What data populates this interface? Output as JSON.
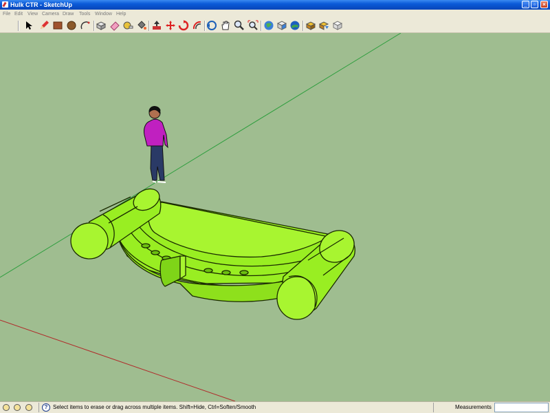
{
  "window": {
    "title": "Hulk CTR - SketchUp"
  },
  "menu": {
    "items": [
      "File",
      "Edit",
      "View",
      "Camera",
      "Draw",
      "Tools",
      "Window",
      "Help"
    ]
  },
  "colors": {
    "viewport": "#9fbd90",
    "model": "#99ee22",
    "person_shirt": "#c020c0",
    "green_axis": "#2e9e3e",
    "red_axis": "#b02a2a"
  },
  "toolbar": {
    "tools": [
      {
        "name": "select-icon"
      },
      {
        "name": "pencil-icon"
      },
      {
        "name": "rectangle-icon"
      },
      {
        "name": "circle-icon"
      },
      {
        "name": "arc-icon"
      },
      {
        "name": "make-component-icon"
      },
      {
        "name": "eraser-icon"
      },
      {
        "name": "tape-measure-icon"
      },
      {
        "name": "paint-bucket-icon"
      },
      {
        "name": "push-pull-icon"
      },
      {
        "name": "move-icon"
      },
      {
        "name": "rotate-icon"
      },
      {
        "name": "offset-icon"
      },
      {
        "name": "orbit-icon"
      },
      {
        "name": "pan-icon"
      },
      {
        "name": "zoom-icon"
      },
      {
        "name": "zoom-extents-icon"
      },
      {
        "name": "get-models-icon"
      },
      {
        "name": "share-model-icon"
      },
      {
        "name": "google-earth-icon"
      },
      {
        "name": "component-warehouse-icon"
      },
      {
        "name": "share-component-icon"
      },
      {
        "name": "layout-icon"
      }
    ]
  },
  "status": {
    "message": "Select items to erase or drag across multiple items. Shift=Hide, Ctrl=Soften/Smooth",
    "measurements_label": "Measurements",
    "measurements_value": ""
  }
}
